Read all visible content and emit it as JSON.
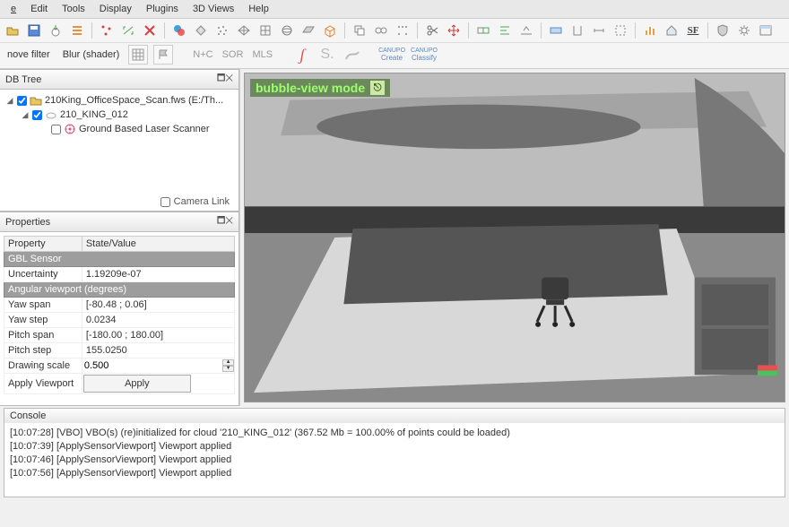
{
  "menu": {
    "file": "e",
    "edit": "Edit",
    "tools": "Tools",
    "display": "Display",
    "plugins": "Plugins",
    "views3d": "3D Views",
    "help": "Help"
  },
  "toolbar2": {
    "remove_filter": "nove filter",
    "blur_shader": "Blur (shader)",
    "nc": "N+C",
    "sor": "SOR",
    "mls": "MLS",
    "create": "Create",
    "classify": "Classify"
  },
  "dbtree": {
    "title": "DB Tree",
    "item1": "210King_OfficeSpace_Scan.fws (E:/Th...",
    "item2": "210_KING_012",
    "item3": "Ground Based Laser Scanner",
    "camlink": "Camera Link"
  },
  "properties": {
    "title": "Properties",
    "col_property": "Property",
    "col_state": "State/Value",
    "gbl_sensor": "GBL Sensor",
    "uncertainty_l": "Uncertainty",
    "uncertainty_v": "1.19209e-07",
    "ang_vp": "Angular viewport (degrees)",
    "yawspan_l": "Yaw span",
    "yawspan_v": "[-80.48 ; 0.06]",
    "yawstep_l": "Yaw step",
    "yawstep_v": "0.0234",
    "pitchspan_l": "Pitch span",
    "pitchspan_v": "[-180.00 ; 180.00]",
    "pitchstep_l": "Pitch step",
    "pitchstep_v": "155.0250",
    "drawscale_l": "Drawing scale",
    "drawscale_v": "0.500",
    "applyvp_l": "Apply Viewport",
    "apply_btn": "Apply"
  },
  "viewport": {
    "mode_label": "bubble-view mode"
  },
  "console": {
    "title": "Console",
    "l1": "[10:07:28] [VBO] VBO(s) (re)initialized for cloud '210_KING_012' (367.52 Mb = 100.00% of points could be loaded)",
    "l2": "[10:07:39] [ApplySensorViewport] Viewport applied",
    "l3": "[10:07:46] [ApplySensorViewport] Viewport applied",
    "l4": "[10:07:56] [ApplySensorViewport] Viewport applied"
  }
}
